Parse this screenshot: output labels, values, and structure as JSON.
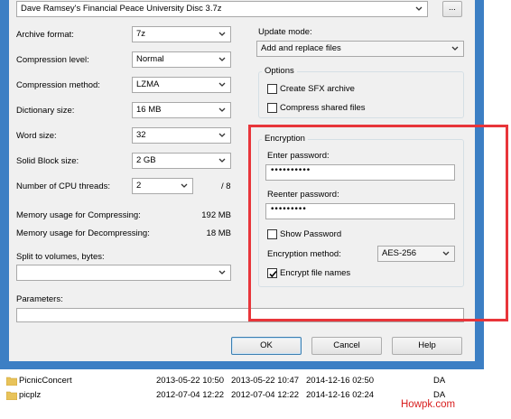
{
  "archive": {
    "path": "Dave Ramsey's Financial Peace University Disc 3.7z",
    "browse_label": "..."
  },
  "left": {
    "archive_format": {
      "label": "Archive format:",
      "value": "7z"
    },
    "compression_level": {
      "label": "Compression level:",
      "value": "Normal"
    },
    "compression_method": {
      "label": "Compression method:",
      "value": "LZMA"
    },
    "dictionary_size": {
      "label": "Dictionary size:",
      "value": "16 MB"
    },
    "word_size": {
      "label": "Word size:",
      "value": "32"
    },
    "solid_block_size": {
      "label": "Solid Block size:",
      "value": "2 GB"
    },
    "cpu_threads": {
      "label": "Number of CPU threads:",
      "value": "2",
      "max": "/ 8"
    },
    "memory_compress": {
      "label": "Memory usage for Compressing:",
      "value": "192 MB"
    },
    "memory_decompress": {
      "label": "Memory usage for Decompressing:",
      "value": "18 MB"
    },
    "split_volumes": {
      "label": "Split to volumes, bytes:",
      "value": ""
    }
  },
  "right": {
    "update_mode": {
      "label": "Update mode:",
      "value": "Add and replace files"
    },
    "options": {
      "title": "Options",
      "create_sfx": "Create SFX archive",
      "compress_shared": "Compress shared files"
    },
    "encryption": {
      "title": "Encryption",
      "enter_password_label": "Enter password:",
      "enter_password_value": "••••••••••",
      "reenter_password_label": "Reenter password:",
      "reenter_password_value": "•••••••••",
      "show_password": "Show Password",
      "method_label": "Encryption method:",
      "method_value": "AES-256",
      "encrypt_names": "Encrypt file names"
    }
  },
  "parameters": {
    "label": "Parameters:",
    "value": ""
  },
  "buttons": {
    "ok": "OK",
    "cancel": "Cancel",
    "help": "Help"
  },
  "files": [
    {
      "name": "PicnicConcert",
      "modified": "2013-05-22 10:50",
      "created": "2013-05-22 10:47",
      "accessed": "2014-12-16 02:50",
      "attr": "DA"
    },
    {
      "name": "picplz",
      "modified": "2012-07-04 12:22",
      "created": "2012-07-04 12:22",
      "accessed": "2014-12-16 02:24",
      "attr": "DA"
    }
  ],
  "watermark": "Howpk.com",
  "colors": {
    "highlight": "#e8353a",
    "frame": "#3c7fc4",
    "watermark": "#d81e1e"
  }
}
